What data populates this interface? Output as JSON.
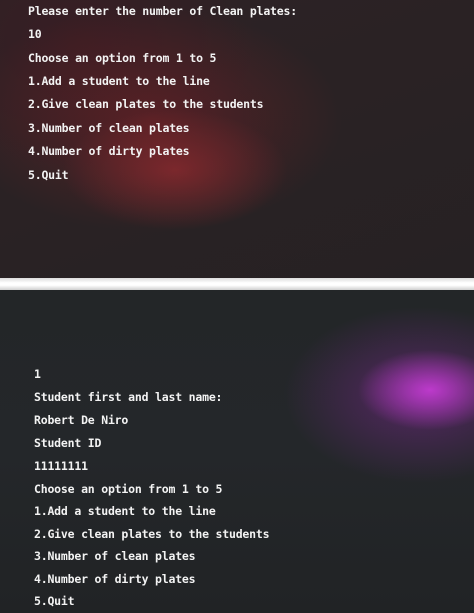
{
  "top_screen": {
    "lines": [
      "Please enter the number of Clean plates:",
      "10",
      "Choose an option from 1 to 5",
      "1.Add a student to the line",
      "2.Give clean plates to the students",
      "3.Number of clean plates",
      "4.Number of dirty plates",
      "5.Quit"
    ]
  },
  "bottom_screen": {
    "lines": [
      "1",
      "Student first and last name:",
      "Robert De Niro",
      "Student ID",
      "11111111",
      "Choose an option from 1 to 5",
      "1.Add a student to the line",
      "2.Give clean plates to the students",
      "3.Number of clean plates",
      "4.Number of dirty plates",
      "5.Quit"
    ]
  }
}
